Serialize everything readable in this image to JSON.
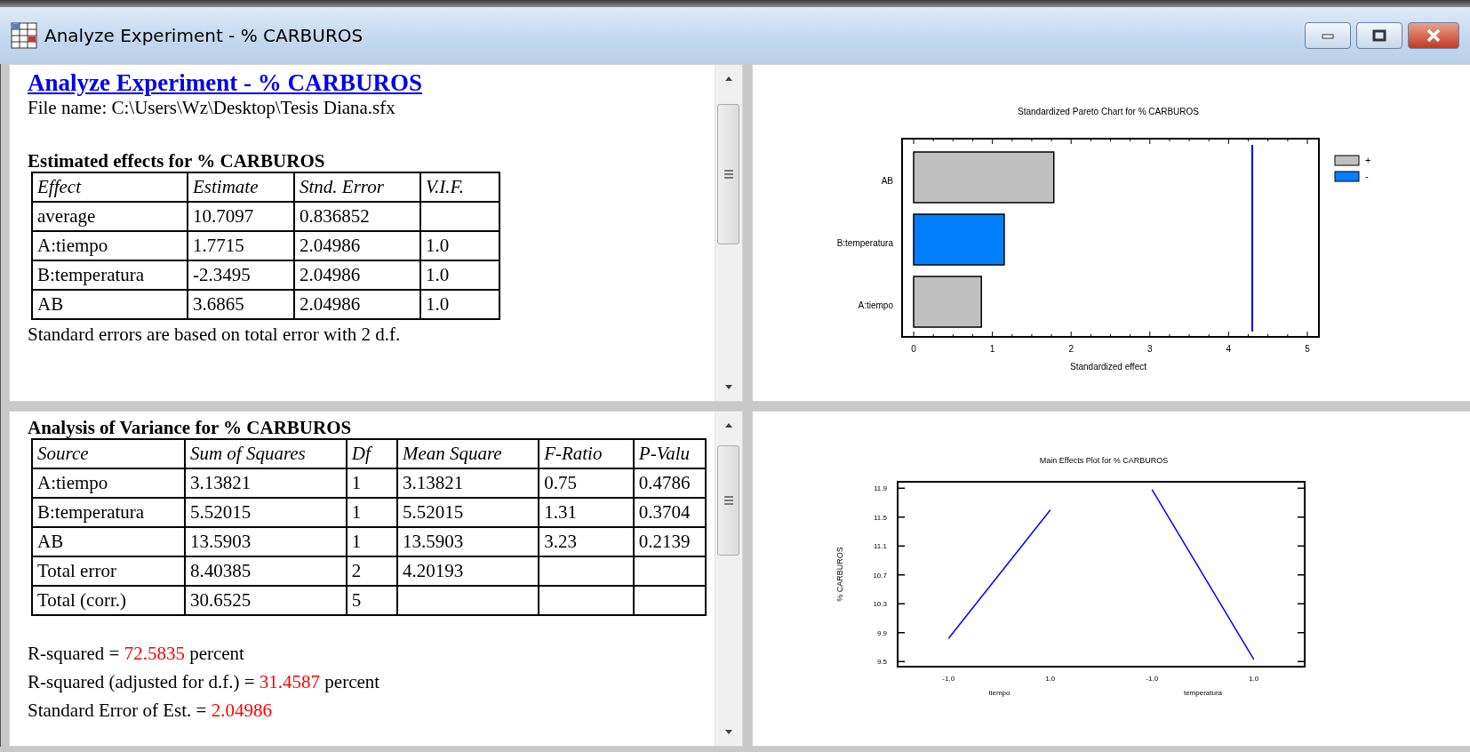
{
  "window": {
    "title": "Analyze Experiment - % CARBUROS"
  },
  "summary_pane": {
    "heading": "Analyze Experiment - % CARBUROS",
    "file_name": "File name: C:\\Users\\Wz\\Desktop\\Tesis Diana.sfx",
    "table_title": "Estimated effects for % CARBUROS",
    "columns": [
      "Effect",
      "Estimate",
      "Stnd. Error",
      "V.I.F."
    ],
    "rows": [
      [
        "average",
        "10.7097",
        "0.836852",
        ""
      ],
      [
        "A:tiempo",
        "1.7715",
        "2.04986",
        "1.0"
      ],
      [
        "B:temperatura",
        "-2.3495",
        "2.04986",
        "1.0"
      ],
      [
        "AB",
        "3.6865",
        "2.04986",
        "1.0"
      ]
    ],
    "footnote": "Standard errors are based on total error with 2 d.f."
  },
  "anova_pane": {
    "table_title": "Analysis of Variance for % CARBUROS",
    "columns": [
      "Source",
      "Sum of Squares",
      "Df",
      "Mean Square",
      "F-Ratio",
      "P-Valu"
    ],
    "rows": [
      [
        "A:tiempo",
        "3.13821",
        "1",
        "3.13821",
        "0.75",
        "0.4786"
      ],
      [
        "B:temperatura",
        "5.52015",
        "1",
        "5.52015",
        "1.31",
        "0.3704"
      ],
      [
        "AB",
        "13.5903",
        "1",
        "13.5903",
        "3.23",
        "0.2139"
      ],
      [
        "Total error",
        "8.40385",
        "2",
        "4.20193",
        "",
        ""
      ],
      [
        "Total (corr.)",
        "30.6525",
        "5",
        "",
        "",
        ""
      ]
    ],
    "statistics": [
      {
        "label": "R-squared =",
        "value": "72.5835",
        "unit": "percent"
      },
      {
        "label": "R-squared (adjusted for d.f.) =",
        "value": "31.4587",
        "unit": "percent"
      },
      {
        "label": "Standard Error of Est. =",
        "value": "2.04986"
      }
    ]
  },
  "pareto_chart": {
    "chart_data": {
      "type": "bar",
      "orientation": "horizontal",
      "legend": true,
      "title": "Standardized Pareto Chart for % CARBUROS",
      "xlabel": "Standardized effect",
      "categories": [
        "AB",
        "B:temperatura",
        "A:tiempo"
      ],
      "series": [
        {
          "name": "+",
          "color": "#c0c0c0",
          "values": [
            1.78,
            null,
            0.86
          ]
        },
        {
          "name": "-",
          "color": "#0080ff",
          "values": [
            null,
            1.15,
            null
          ]
        }
      ],
      "xlim": [
        -0.147,
        5.147
      ],
      "xticks": [
        0,
        1,
        2,
        3,
        4,
        5
      ],
      "ref_lines": [
        {
          "axis": "x",
          "value": 4.3
        }
      ]
    }
  },
  "effects_chart": {
    "factor_labels": [
      "tiempo",
      "temperatura"
    ],
    "chart_data": {
      "type": "line",
      "title": "Main Effects Plot for % CARBUROS",
      "ylabel": "% CARBUROS",
      "categories": [
        "-1.0",
        "1.0",
        "-1.0",
        "1.0"
      ],
      "series": [
        {
          "color": "#0000ff",
          "values": [
            9.82,
            11.6,
            null,
            null
          ]
        },
        {
          "color": "#0000ff",
          "values": [
            null,
            null,
            11.88,
            9.53
          ]
        }
      ],
      "ylim": [
        9.43,
        11.99
      ],
      "yticks": [
        9.5,
        9.9,
        10.3,
        10.7,
        11.1,
        11.5,
        11.9
      ]
    }
  }
}
